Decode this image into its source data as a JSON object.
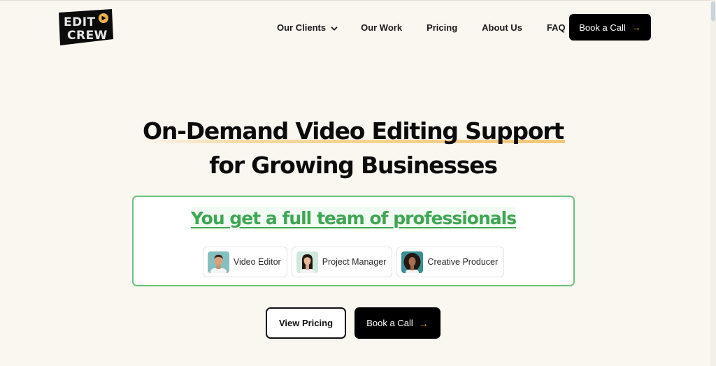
{
  "brand": {
    "logo_line1": "EDIT",
    "logo_line2": "CREW",
    "logo_icon": "play-circle-icon",
    "accent_color": "#e9b44c"
  },
  "nav": {
    "items": [
      {
        "label": "Our Clients",
        "has_dropdown": true,
        "icon": "chevron-down-icon"
      },
      {
        "label": "Our Work"
      },
      {
        "label": "Pricing"
      },
      {
        "label": "About Us"
      },
      {
        "label": "FAQ"
      }
    ],
    "cta": {
      "label": "Book a Call",
      "icon": "arrow-right-icon",
      "glyph": "→"
    }
  },
  "hero": {
    "title_line1": "On-Demand Video Editing Support",
    "title_line2": "for Growing Businesses",
    "highlight_color": "#f2c777"
  },
  "team": {
    "heading": "You get a full team of professionals",
    "heading_color": "#3fa654",
    "border_color": "#6cc27c",
    "members": [
      {
        "role": "Video Editor",
        "avatar": "man-avatar",
        "avatar_bg": "#86bfc0"
      },
      {
        "role": "Project Manager",
        "avatar": "woman-avatar",
        "avatar_bg": "#cfe8dc"
      },
      {
        "role": "Creative Producer",
        "avatar": "woman-curly-hair-avatar",
        "avatar_bg": "#3a8f94"
      }
    ]
  },
  "actions": {
    "view_pricing": "View Pricing",
    "book_call": "Book a Call",
    "book_call_glyph": "→"
  }
}
